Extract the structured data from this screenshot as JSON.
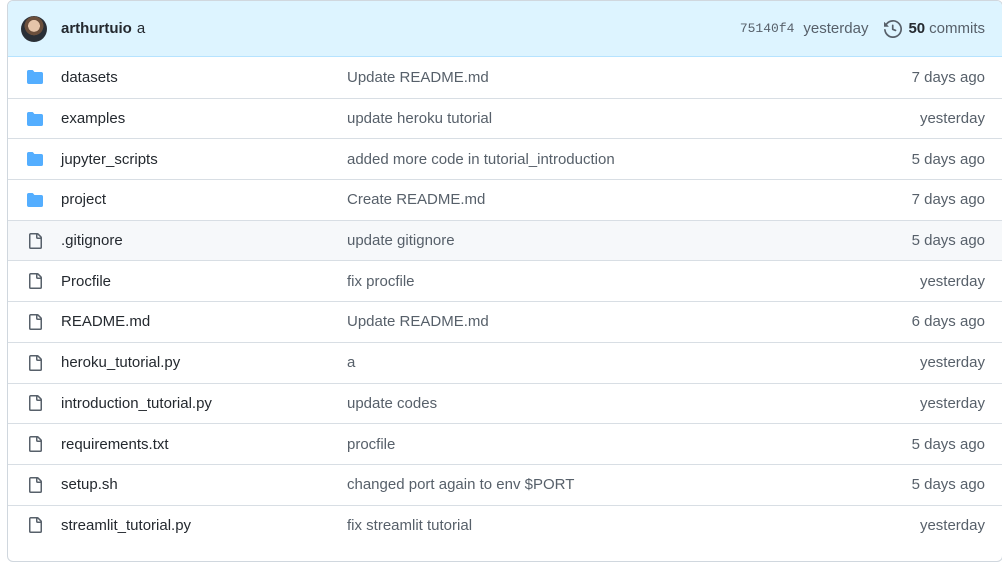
{
  "latest_commit": {
    "author": "arthurtuio",
    "message": "a",
    "sha": "75140f4",
    "when": "yesterday",
    "commits_count": "50",
    "commits_label": "commits"
  },
  "files": [
    {
      "type": "folder",
      "name": "datasets",
      "message": "Update README.md",
      "age": "7 days ago"
    },
    {
      "type": "folder",
      "name": "examples",
      "message": "update heroku tutorial",
      "age": "yesterday"
    },
    {
      "type": "folder",
      "name": "jupyter_scripts",
      "message": "added more code in tutorial_introduction",
      "age": "5 days ago"
    },
    {
      "type": "folder",
      "name": "project",
      "message": "Create README.md",
      "age": "7 days ago"
    },
    {
      "type": "file",
      "name": ".gitignore",
      "message": "update gitignore",
      "age": "5 days ago"
    },
    {
      "type": "file",
      "name": "Procfile",
      "message": "fix procfile",
      "age": "yesterday"
    },
    {
      "type": "file",
      "name": "README.md",
      "message": "Update README.md",
      "age": "6 days ago"
    },
    {
      "type": "file",
      "name": "heroku_tutorial.py",
      "message": "a",
      "age": "yesterday"
    },
    {
      "type": "file",
      "name": "introduction_tutorial.py",
      "message": "update codes",
      "age": "yesterday"
    },
    {
      "type": "file",
      "name": "requirements.txt",
      "message": "procfile",
      "age": "5 days ago"
    },
    {
      "type": "file",
      "name": "setup.sh",
      "message": "changed port again to env $PORT",
      "age": "5 days ago"
    },
    {
      "type": "file",
      "name": "streamlit_tutorial.py",
      "message": "fix streamlit tutorial",
      "age": "yesterday"
    }
  ],
  "colors": {
    "folder": "#54aeff",
    "file_icon": "#57606a",
    "commit_bar": "#ddf4ff"
  }
}
